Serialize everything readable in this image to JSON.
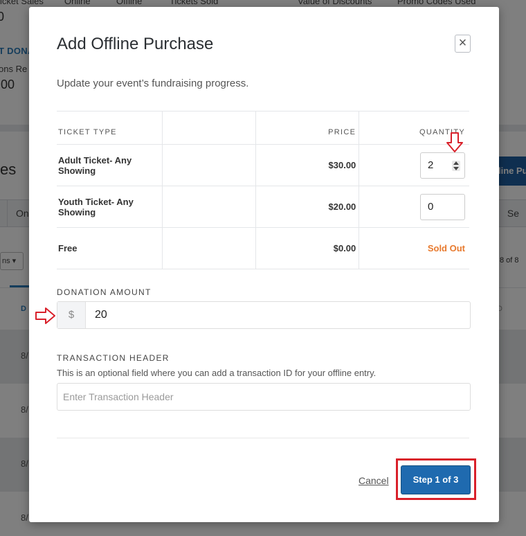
{
  "background": {
    "stat_labels": [
      "icket Sales",
      "Online",
      "Offline",
      "Tickets Sold",
      "Value of Discounts",
      "Promo Codes Used"
    ],
    "stat_value_1": "0",
    "link_text": "T DONA",
    "donations_label": "ons Re",
    "donations_value": ".00",
    "section_title": "es",
    "tab_1": "On",
    "tab_right": "Se",
    "add_button": "line Pu",
    "filter_label": "ns",
    "pager": "8 of 8",
    "table_head_left": "D",
    "table_head_right": "D",
    "row_dates": [
      "8/",
      "8/",
      "8/",
      "8/"
    ]
  },
  "modal": {
    "title": "Add Offline Purchase",
    "subtitle": "Update your event’s fundraising progress.",
    "close_label": "×",
    "table": {
      "headers": {
        "type": "TICKET TYPE",
        "price": "PRICE",
        "quantity": "QUANTITY"
      },
      "rows": [
        {
          "type": "Adult Ticket- Any Showing",
          "price": "$30.00",
          "quantity": "2"
        },
        {
          "type": "Youth Ticket- Any Showing",
          "price": "$20.00",
          "quantity": "0"
        },
        {
          "type": "Free",
          "price": "$0.00",
          "status": "Sold Out"
        }
      ]
    },
    "donation": {
      "label": "DONATION AMOUNT",
      "currency_symbol": "$",
      "value": "20"
    },
    "transaction": {
      "label": "TRANSACTION HEADER",
      "help": "This is an optional field where you can add a transaction ID for your offline entry.",
      "placeholder": "Enter Transaction Header"
    },
    "cancel_label": "Cancel",
    "step_label": "Step 1 of 3"
  },
  "colors": {
    "primary": "#1f6aaf",
    "sold_out": "#e87a2e",
    "annotation": "#d9202a"
  }
}
